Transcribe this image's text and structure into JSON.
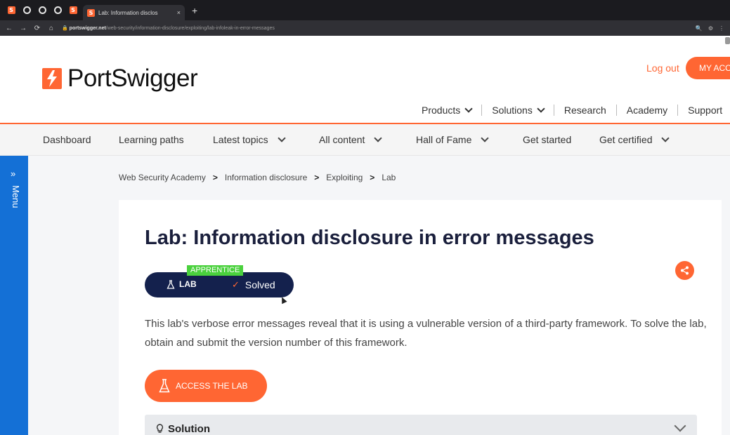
{
  "browser": {
    "tab_title": "Lab: Information disclos",
    "tab_close": "×",
    "new_tab": "+",
    "url_domain": "portswigger.net",
    "url_path": "/web-security/information-disclosure/exploiting/lab-infoleak-in-error-messages"
  },
  "header": {
    "logo_text": "PortSwigger",
    "logout": "Log out",
    "my_account": "MY ACCOUNT",
    "top_nav": [
      "Products",
      "Solutions",
      "Research",
      "Academy",
      "Support"
    ]
  },
  "subnav": [
    "Dashboard",
    "Learning paths",
    "Latest topics",
    "All content",
    "Hall of Fame",
    "Get started",
    "Get certified"
  ],
  "side_menu": {
    "arrows": "»",
    "label": "Menu"
  },
  "breadcrumb": [
    "Web Security Academy",
    "Information disclosure",
    "Exploiting",
    "Lab"
  ],
  "breadcrumb_sep": ">",
  "lab": {
    "title": "Lab: Information disclosure in error messages",
    "level": "APPRENTICE",
    "badge_label": "LAB",
    "status": "Solved",
    "description": "This lab's verbose error messages reveal that it is using a vulnerable version of a third-party framework. To solve the lab, obtain and submit the version number of this framework.",
    "access_button": "ACCESS THE LAB",
    "solution_label": "Solution"
  },
  "colors": {
    "brand": "#ff6633",
    "navy": "#14214d",
    "menu_blue": "#1470d6",
    "apprentice_green": "#4ad13d"
  }
}
